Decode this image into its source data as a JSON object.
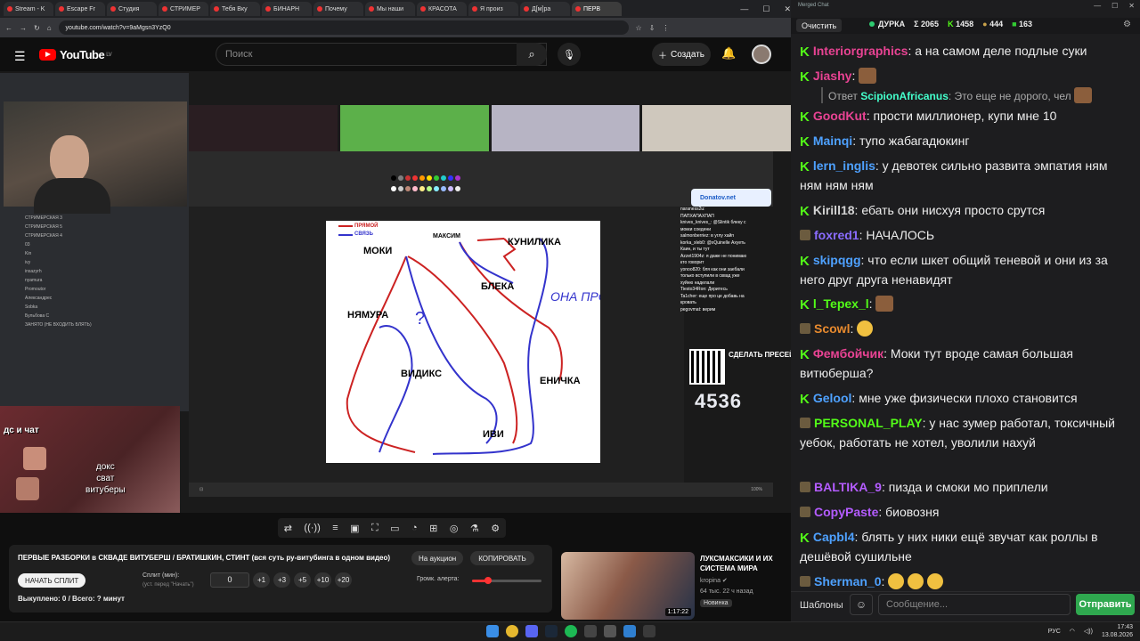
{
  "browser": {
    "tabs": [
      "Stream - K",
      "Escape Fr",
      "Студия",
      "СТРИМЕР",
      "Тебя Вку",
      "БИНАРН",
      "Почему",
      "Мы наши",
      "КРАСОТА",
      "Я произ",
      "Д[м]ра",
      "ПЕРВ"
    ],
    "url": "youtube.com/watch?v=9aMgsn3YzQ0"
  },
  "youtube": {
    "logo": "YouTube",
    "region": "LV",
    "search_placeholder": "Поиск",
    "create_label": "Создать"
  },
  "stream": {
    "paint_labels": [
      "ПРЯМОЙ",
      "СВЯЗЬ",
      "МОКИ",
      "МАКСИМ",
      "КУНИЛИКА",
      "БЛЕКА",
      "ОНА ПРОП",
      "НЯМУРА",
      "ВИДИКС",
      "ЕНИЧКА",
      "ИВИ"
    ],
    "donate_site": "Donatov.net",
    "chat_lines": [
      "naraness2u:",
      "ПАПХАПАХПАП",
      "knives_knives_: @Slintik блеку с",
      "мокки соедени",
      "salmonberriez: в углу хайп",
      "korka_xleb0: @xQuinelle Ахуеть",
      "Каин, и ты тут",
      "Azzet1904z: я даже не понимаю",
      "кто говорит",
      "yonoo820: бля как они заебали",
      "только вступили в сквад уже",
      "хуйню наделали",
      "Tiesto34Ron: Деритесь",
      "Ta1cher: еще про це добавь на",
      "кровать",
      "pegovmat: верим"
    ],
    "qr_text": "СДЕЛАТЬ ПРЕСЕЙВ",
    "counter": "4536",
    "cam_label": "дс и чат",
    "cam_text": "докс\nсват\nвитуберы",
    "discord_channels": [
      "СТРИМЕРСКАЯ 3",
      "СТРИМЕРСКАЯ 5",
      "СТРИМЕРСКАЯ 4",
      "03",
      "Kin",
      "ivy",
      "insazyrh",
      "nyamura",
      "Promoutor",
      "Александрес",
      "Sobka",
      "Бульбова С",
      "ЗАНЯТО (НЕ ВХОДИТЬ БЛЯТЬ)"
    ]
  },
  "player": {
    "title": "ПЕРВЫЕ РАЗБОРКИ в СКВАДЕ ВИТУБЕРШ / БРАТИШКИН, СТИНТ (вся суть ру-витубинга в одном видео)",
    "auction_label": "На аукцион",
    "copy_label": "КОПИРОВАТЬ",
    "split_button": "НАЧАТЬ СПЛИТ",
    "split_label": "Сплит (мин):",
    "split_hint": "(уст. перед \"Начать\")",
    "split_value": "0",
    "steps": [
      "+1",
      "+3",
      "+5",
      "+10",
      "+20"
    ],
    "alert_volume_label": "Громк. алерта:",
    "alert_volume": 0.22,
    "bought": "Выкуплено: 0 / Всего: ? минут"
  },
  "recommended": {
    "title": "ЛУКСМАКСИКИ И ИХ СИСТЕМА МИРА",
    "channel": "kropina",
    "meta": "64 тыс.  22 ч назад",
    "badge": "Новинка",
    "duration": "1:17:22"
  },
  "taskbar": {
    "lang": "РУС",
    "time": "17:43",
    "date": "13.08.2026"
  },
  "chat": {
    "window_title": "Merged Chat",
    "clear_label": "Очистить",
    "channel": "ДУРКА",
    "stat_total": "Σ 2065",
    "stat_kick": "1458",
    "stat_twitch": "444",
    "stat_other": "163",
    "messages": [
      {
        "platform": "kick",
        "nick": "Interiorgraphics",
        "color": "#e84393",
        "text": "а на самом деле подлые суки"
      },
      {
        "platform": "kick",
        "nick": "Jiashy",
        "color": "#e84393",
        "text": "",
        "emote": true
      },
      {
        "platform": "reply",
        "nick": "ScipionAfricanus",
        "text": "Ответ",
        "reply_text": "Это еще не дорого, чел"
      },
      {
        "platform": "kick",
        "nick": "GoodKut",
        "color": "#e84393",
        "text": "прости миллионер, купи мне 10"
      },
      {
        "platform": "kick",
        "nick": "Mainqi",
        "color": "#4ea1ff",
        "text": "тупо жабагадюкинг"
      },
      {
        "platform": "kick",
        "nick": "lern_inglis",
        "color": "#4ea1ff",
        "text": "у девотек сильно развита эмпатия ням ням ням ням"
      },
      {
        "platform": "kick",
        "nick": "Kirill18",
        "color": "#d3d3d3",
        "text": "ебать они нисхуя просто срутся"
      },
      {
        "platform": "twitch",
        "nick": "foxred1",
        "color": "#8a6cff",
        "text": "НАЧАЛОСЬ"
      },
      {
        "platform": "kick",
        "nick": "skipqgg",
        "color": "#4ea1ff",
        "text": "что если шкет общий теневой и они из за него друг друга ненавидят"
      },
      {
        "platform": "kick",
        "nick": "l_Tepex_l",
        "color": "#53fc18",
        "text": "",
        "emote": true
      },
      {
        "platform": "twitch",
        "nick": "Scowl",
        "color": "#e88a2e",
        "text": "",
        "emote_round": true
      },
      {
        "platform": "kick",
        "nick": "Фембойчик",
        "color": "#e84393",
        "text": "Моки тут вроде самая большая витюберша?"
      },
      {
        "platform": "kick",
        "nick": "Gelool",
        "color": "#4ea1ff",
        "text": "мне уже физически плохо становится"
      },
      {
        "platform": "twitch",
        "nick": "PERSONAL_PLAY",
        "color": "#53fc18",
        "text": "у нас зумер работал, токсичный уебок, работать не хотел, уволили нахуй"
      },
      {
        "platform": "twitch",
        "nick": "BALTIKA_9",
        "color": "#b45cff",
        "text": "пизда и смоки мо приплели"
      },
      {
        "platform": "twitch",
        "nick": "CopyPaste",
        "color": "#b45cff",
        "text": "биовозня"
      },
      {
        "platform": "kick",
        "nick": "Capbl4",
        "color": "#4ea1ff",
        "text": "блять у них ники ещё звучат как роллы в дешёвой сушильне"
      },
      {
        "platform": "twitch",
        "nick": "Sherman_0",
        "color": "#4ea1ff",
        "text": "",
        "emote_triple": true
      }
    ],
    "templates_label": "Шаблоны",
    "input_placeholder": "Сообщение...",
    "send_label": "Отправить"
  }
}
